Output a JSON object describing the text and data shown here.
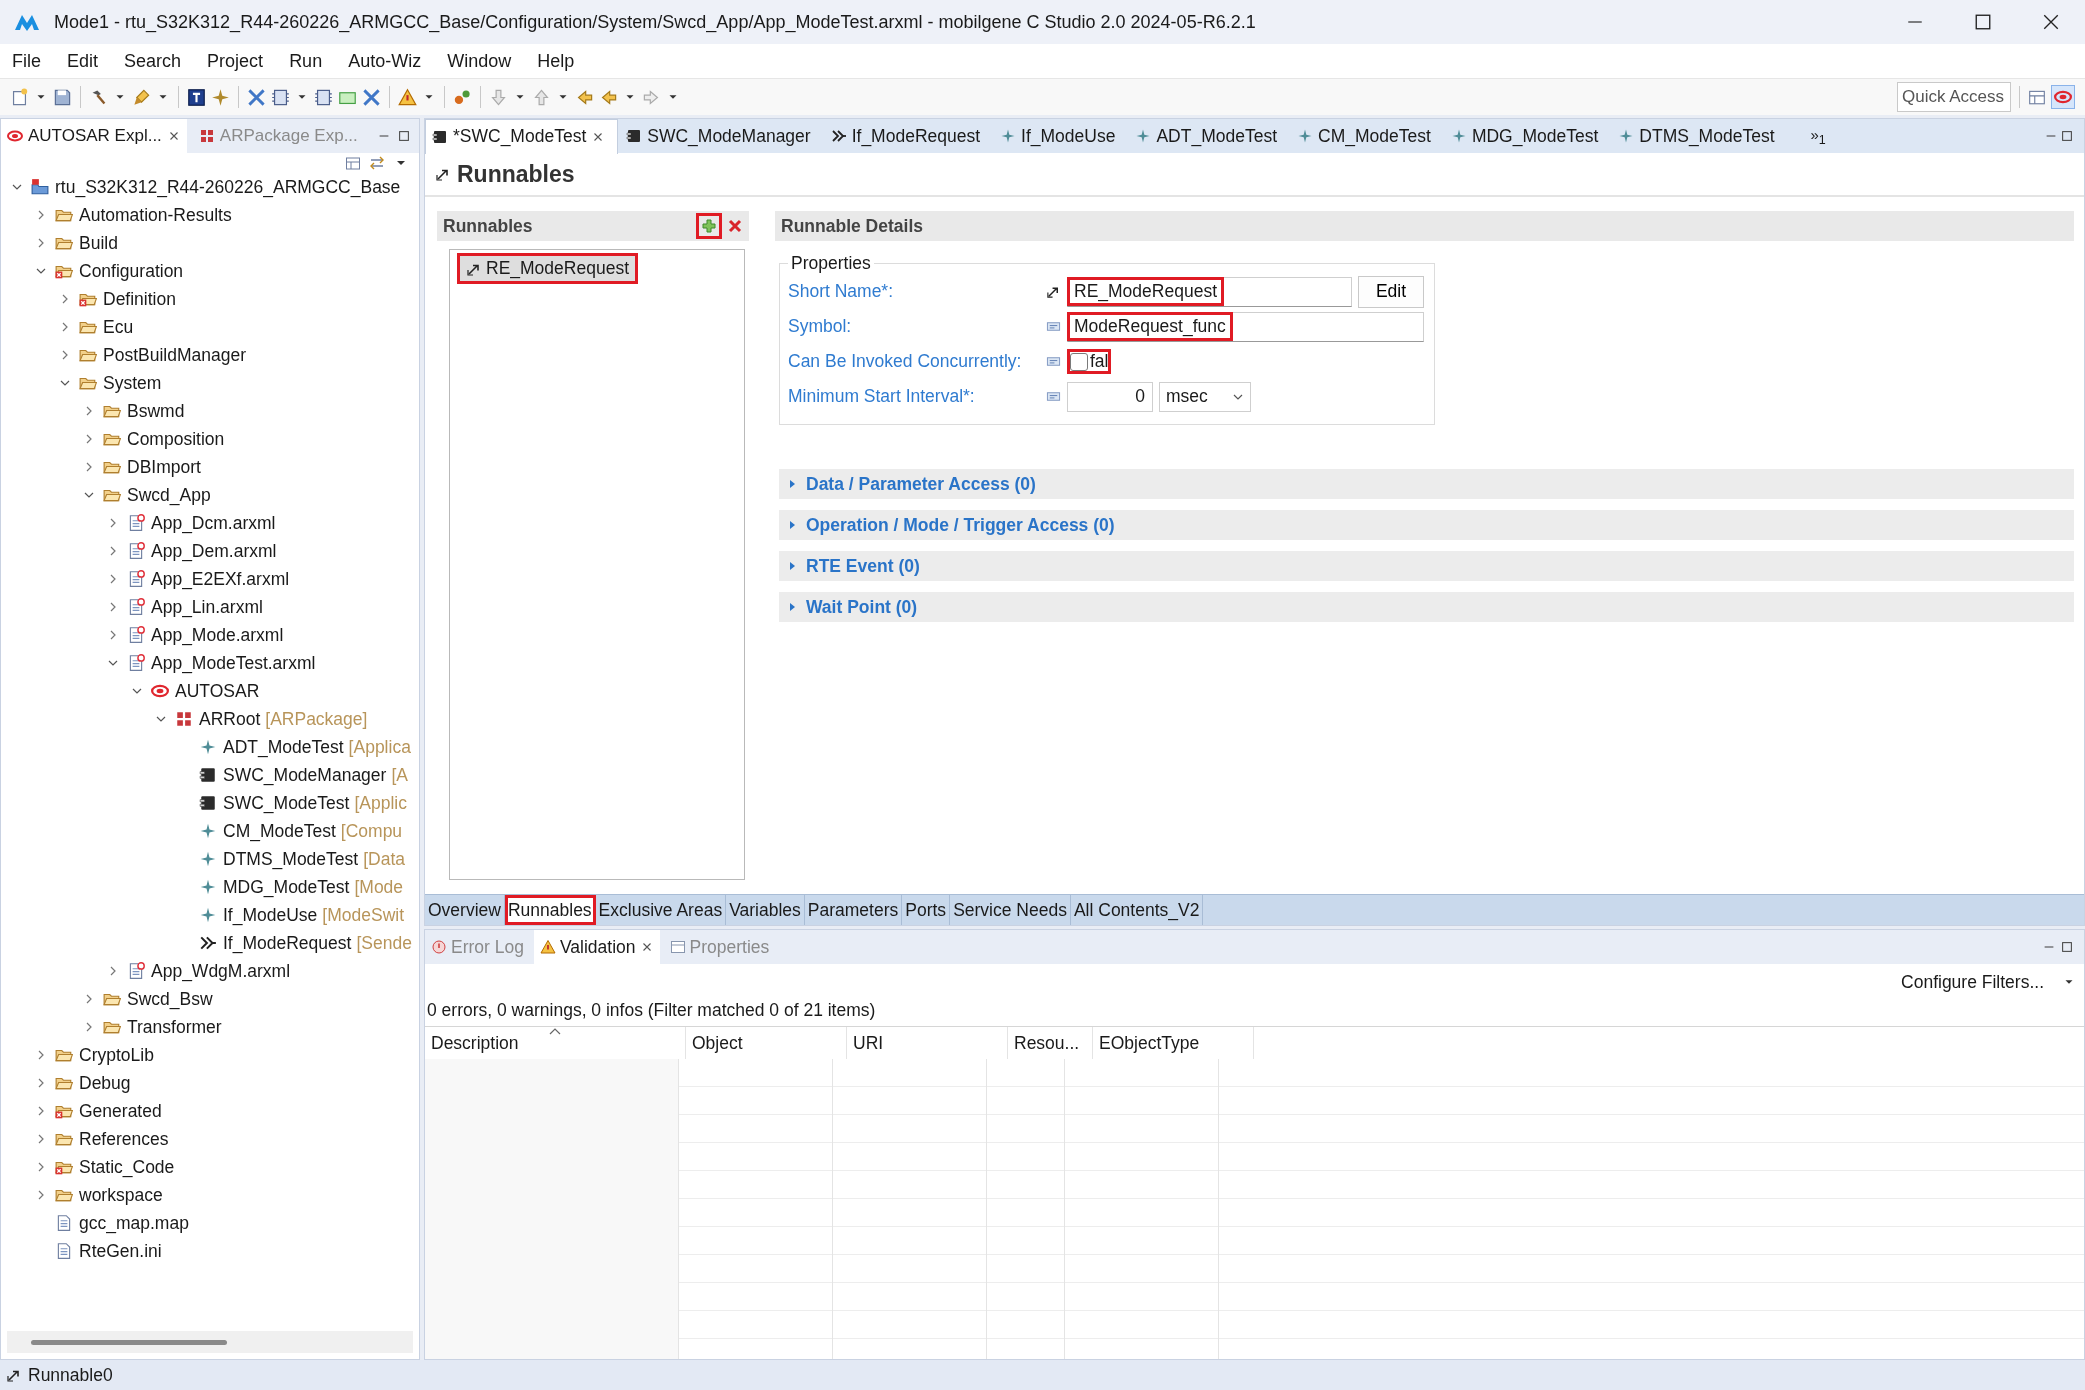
{
  "window": {
    "title": "Mode1 - rtu_S32K312_R44-260226_ARMGCC_Base/Configuration/System/Swcd_App/App_ModeTest.arxml - mobilgene C Studio 2.0 2024-05-R6.2.1"
  },
  "menu": [
    "File",
    "Edit",
    "Search",
    "Project",
    "Run",
    "Auto-Wiz",
    "Window",
    "Help"
  ],
  "quick_access": {
    "placeholder": "Quick Access"
  },
  "explorer": {
    "tabs": [
      {
        "label": "AUTOSAR Expl...",
        "selected": true
      },
      {
        "label": "ARPackage Exp...",
        "selected": false
      }
    ],
    "tree": [
      {
        "label": "rtu_S32K312_R44-260226_ARMGCC_Base",
        "kind": "project",
        "expanded": true,
        "children": [
          {
            "label": "Automation-Results",
            "kind": "folder",
            "expanded": false
          },
          {
            "label": "Build",
            "kind": "folder",
            "expanded": false
          },
          {
            "label": "Configuration",
            "kind": "folder-error",
            "expanded": true,
            "children": [
              {
                "label": "Definition",
                "kind": "folder-error",
                "expanded": false
              },
              {
                "label": "Ecu",
                "kind": "folder",
                "expanded": false
              },
              {
                "label": "PostBuildManager",
                "kind": "folder",
                "expanded": false
              },
              {
                "label": "System",
                "kind": "folder",
                "expanded": true,
                "children": [
                  {
                    "label": "Bswmd",
                    "kind": "folder",
                    "expanded": false
                  },
                  {
                    "label": "Composition",
                    "kind": "folder",
                    "expanded": false
                  },
                  {
                    "label": "DBImport",
                    "kind": "folder",
                    "expanded": false
                  },
                  {
                    "label": "Swcd_App",
                    "kind": "folder",
                    "expanded": true,
                    "children": [
                      {
                        "label": "App_Dcm.arxml",
                        "kind": "arxml",
                        "expanded": false
                      },
                      {
                        "label": "App_Dem.arxml",
                        "kind": "arxml",
                        "expanded": false
                      },
                      {
                        "label": "App_E2EXf.arxml",
                        "kind": "arxml",
                        "expanded": false
                      },
                      {
                        "label": "App_Lin.arxml",
                        "kind": "arxml",
                        "expanded": false
                      },
                      {
                        "label": "App_Mode.arxml",
                        "kind": "arxml",
                        "expanded": false
                      },
                      {
                        "label": "App_ModeTest.arxml",
                        "kind": "arxml",
                        "expanded": true,
                        "children": [
                          {
                            "label": "AUTOSAR",
                            "kind": "autosar",
                            "expanded": true,
                            "children": [
                              {
                                "label": "ARRoot",
                                "suffix": "[ARPackage]",
                                "kind": "package",
                                "expanded": true,
                                "children": [
                                  {
                                    "label": "ADT_ModeTest",
                                    "suffix": "[Applica",
                                    "kind": "element"
                                  },
                                  {
                                    "label": "SWC_ModeManager",
                                    "suffix": "[A",
                                    "kind": "component"
                                  },
                                  {
                                    "label": "SWC_ModeTest",
                                    "suffix": "[Applic",
                                    "kind": "component"
                                  },
                                  {
                                    "label": "CM_ModeTest",
                                    "suffix": "[Compu",
                                    "kind": "element"
                                  },
                                  {
                                    "label": "DTMS_ModeTest",
                                    "suffix": "[Data",
                                    "kind": "element"
                                  },
                                  {
                                    "label": "MDG_ModeTest",
                                    "suffix": "[Mode",
                                    "kind": "element"
                                  },
                                  {
                                    "label": "If_ModeUse",
                                    "suffix": "[ModeSwit",
                                    "kind": "element"
                                  },
                                  {
                                    "label": "If_ModeRequest",
                                    "suffix": "[Sende",
                                    "kind": "interface"
                                  }
                                ]
                              }
                            ]
                          }
                        ]
                      },
                      {
                        "label": "App_WdgM.arxml",
                        "kind": "arxml",
                        "expanded": false
                      }
                    ]
                  },
                  {
                    "label": "Swcd_Bsw",
                    "kind": "folder",
                    "expanded": false
                  },
                  {
                    "label": "Transformer",
                    "kind": "folder",
                    "expanded": false
                  }
                ]
              }
            ]
          },
          {
            "label": "CryptoLib",
            "kind": "folder",
            "expanded": false
          },
          {
            "label": "Debug",
            "kind": "folder",
            "expanded": false
          },
          {
            "label": "Generated",
            "kind": "folder-error",
            "expanded": false
          },
          {
            "label": "References",
            "kind": "folder",
            "expanded": false
          },
          {
            "label": "Static_Code",
            "kind": "folder-error",
            "expanded": false
          },
          {
            "label": "workspace",
            "kind": "folder",
            "expanded": false
          },
          {
            "label": "gcc_map.map",
            "kind": "file"
          },
          {
            "label": "RteGen.ini",
            "kind": "file"
          }
        ]
      }
    ]
  },
  "editor_tabs": [
    {
      "label": "*SWC_ModeTest",
      "kind": "component",
      "selected": true
    },
    {
      "label": "SWC_ModeManager",
      "kind": "component",
      "selected": false
    },
    {
      "label": "If_ModeRequest",
      "kind": "interface",
      "selected": false
    },
    {
      "label": "If_ModeUse",
      "kind": "element",
      "selected": false
    },
    {
      "label": "ADT_ModeTest",
      "kind": "element",
      "selected": false
    },
    {
      "label": "CM_ModeTest",
      "kind": "element",
      "selected": false
    },
    {
      "label": "MDG_ModeTest",
      "kind": "element",
      "selected": false
    },
    {
      "label": "DTMS_ModeTest",
      "kind": "element",
      "selected": false
    }
  ],
  "editor_tabs_overflow": {
    "chevron": "»",
    "count": "1"
  },
  "page_title": "Runnables",
  "runnables": {
    "title": "Runnables",
    "add_highlighted": true,
    "items": [
      {
        "label": "RE_ModeRequest",
        "selected": true,
        "highlighted": true
      }
    ]
  },
  "details": {
    "title": "Runnable Details",
    "group": "Properties",
    "fields": [
      {
        "kind": "text",
        "label": "Short Name*:",
        "value": "RE_ModeRequest",
        "button": "Edit",
        "highlighted": true
      },
      {
        "kind": "text",
        "label": "Symbol:",
        "value": "ModeRequest_func",
        "highlighted": true
      },
      {
        "kind": "boolean",
        "label": "Can Be Invoked Concurrently:",
        "checked": false,
        "value": "fal",
        "highlighted": true
      },
      {
        "kind": "number",
        "label": "Minimum Start Interval*:",
        "value": "0",
        "unit": "msec",
        "highlighted": false
      }
    ],
    "sections": [
      {
        "label": "Data / Parameter Access (0)",
        "expanded": false
      },
      {
        "label": "Operation / Mode / Trigger Access (0)",
        "expanded": false
      },
      {
        "label": "RTE Event (0)",
        "expanded": false
      },
      {
        "label": "Wait Point (0)",
        "expanded": false
      }
    ]
  },
  "page_tabs": [
    {
      "label": "Overview",
      "selected": false,
      "highlighted": false
    },
    {
      "label": "Runnables",
      "selected": true,
      "highlighted": true
    },
    {
      "label": "Exclusive Areas",
      "selected": false,
      "highlighted": false
    },
    {
      "label": "Variables",
      "selected": false,
      "highlighted": false
    },
    {
      "label": "Parameters",
      "selected": false,
      "highlighted": false
    },
    {
      "label": "Ports",
      "selected": false,
      "highlighted": false
    },
    {
      "label": "Service Needs",
      "selected": false,
      "highlighted": false
    },
    {
      "label": "All Contents_V2",
      "selected": false,
      "highlighted": false
    }
  ],
  "bottom_panel": {
    "tabs": [
      {
        "label": "Error Log",
        "selected": false
      },
      {
        "label": "Validation",
        "selected": true
      },
      {
        "label": "Properties",
        "selected": false
      }
    ],
    "configure": "Configure Filters...",
    "summary": "0 errors, 0 warnings, 0 infos (Filter matched 0 of 21 items)",
    "table": {
      "columns": [
        {
          "label": "Description",
          "sorted": true
        },
        {
          "label": "Object",
          "sorted": false
        },
        {
          "label": "URI",
          "sorted": false
        },
        {
          "label": "Resou...",
          "sorted": false
        },
        {
          "label": "EObjectType",
          "sorted": false
        }
      ]
    }
  },
  "status_bar": {
    "text": "Runnable0"
  }
}
